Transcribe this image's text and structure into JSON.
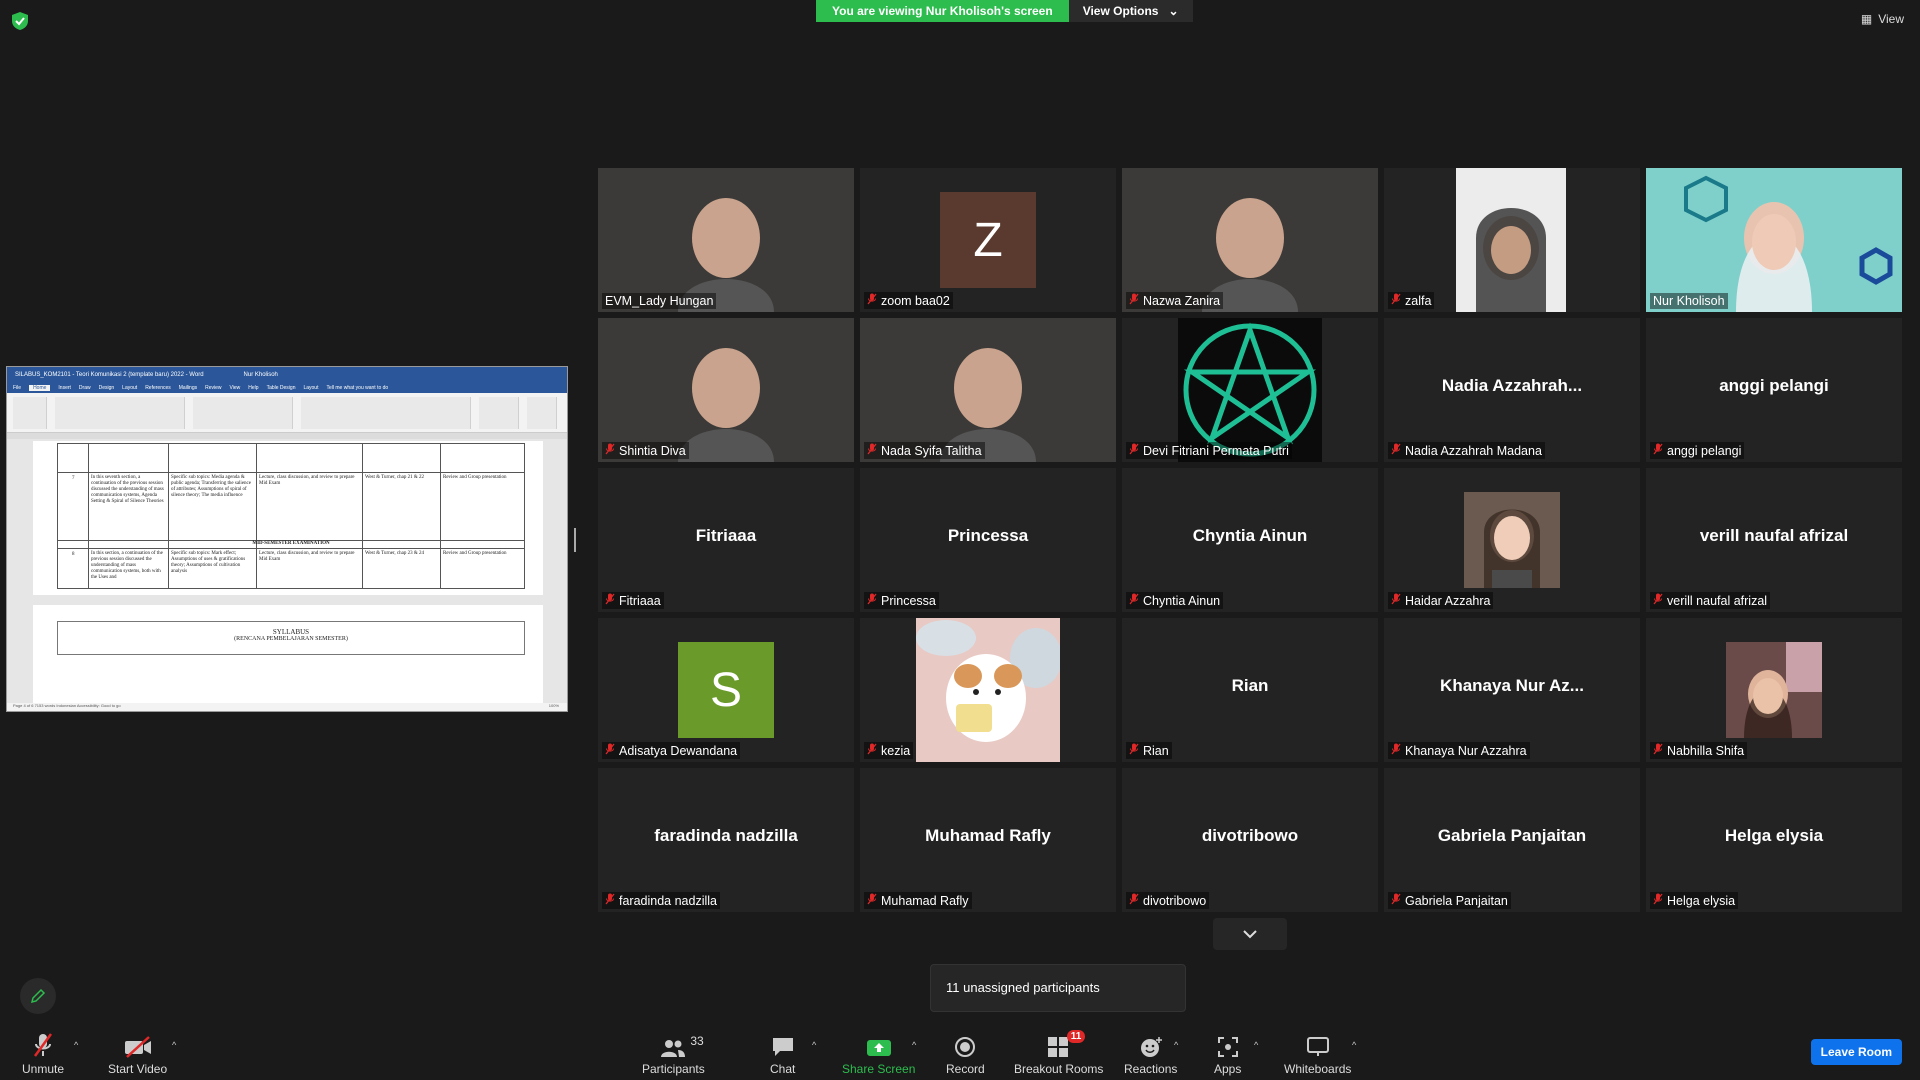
{
  "banner": {
    "viewing_text": "You are viewing Nur Kholisoh's screen",
    "view_options": "View Options"
  },
  "top_right": {
    "view_label": "View"
  },
  "shared_doc": {
    "title": "SILABUS_KOM2101 - Teori Komunikasi 2 (template baru) 2022 - Word",
    "tabs": [
      "File",
      "Home",
      "Insert",
      "Draw",
      "Design",
      "Layout",
      "References",
      "Mailings",
      "Review",
      "View",
      "Help",
      "Table Design",
      "Layout"
    ],
    "tell_me": "Tell me what you want to do",
    "user": "Nur Kholisoh",
    "rows": [
      {
        "no": "7",
        "desc": "In this seventh section, a continuation of the previous session discussed the understanding of mass communication systems, Agenda Setting & Spiral of Silence Theories",
        "topics": "Specific sub topics: Media agenda & public agenda; Transferring the salience of attributes; Assumptions of spiral of silence theory; The media influence",
        "method": "Lecture, class discussion, and review to prepare Mid Exam",
        "ref": "West & Turner, chap 21 & 22",
        "assess": "Review and Group presentation"
      },
      {
        "no": "8",
        "desc": "In this section, a continuation of the previous session discussed the understanding of mass communication systems, both with the Uses and",
        "topics": "Specific sub topics: Mark effect; Assumptions of uses & gratifications theory; Assumptions of cultivation analysis",
        "method": "Lecture, class discussion, and review to prepare Mid Exam",
        "ref": "West & Turner, chap 23 & 24",
        "assess": "Review and Group presentation"
      }
    ],
    "mid_exam": "MID-SEMESTER EXAMINATION",
    "syllabus_title": "SYLLABUS",
    "syllabus_sub": "(RENCANA PEMBELAJARAN SEMESTER)",
    "status": "Page 4 of 6   7153 words   Indonesian   Accessibility: Good to go",
    "zoom": "100%"
  },
  "participants_tiles": [
    {
      "name": "EVM_Lady Hungan",
      "muted": false,
      "kind": "video",
      "active": false
    },
    {
      "name": "zoom baa02",
      "muted": true,
      "kind": "avatar",
      "initial": "Z",
      "color": "#5a3a2e"
    },
    {
      "name": "Nazwa Zanira",
      "muted": true,
      "kind": "video"
    },
    {
      "name": "zalfa",
      "muted": true,
      "kind": "video"
    },
    {
      "name": "Nur Kholisoh",
      "muted": false,
      "kind": "video",
      "active": true
    },
    {
      "name": "Shintia Diva",
      "muted": true,
      "kind": "video"
    },
    {
      "name": "Nada Syifa Talitha",
      "muted": true,
      "kind": "video"
    },
    {
      "name": "Devi Fitriani Permata Putri",
      "muted": true,
      "kind": "pentagram"
    },
    {
      "name": "Nadia Azzahrah Madana",
      "display": "Nadia  Azzahrah...",
      "muted": true,
      "kind": "name"
    },
    {
      "name": "anggi pelangi",
      "display": "anggi pelangi",
      "muted": true,
      "kind": "name"
    },
    {
      "name": "Fitriaaa",
      "display": "Fitriaaa",
      "muted": true,
      "kind": "name"
    },
    {
      "name": "Princessa",
      "display": "Princessa",
      "muted": true,
      "kind": "name"
    },
    {
      "name": "Chyntia Ainun",
      "display": "Chyntia Ainun",
      "muted": true,
      "kind": "name"
    },
    {
      "name": "Haidar Azzahra",
      "muted": true,
      "kind": "photo"
    },
    {
      "name": "verill naufal afrizal",
      "display": "verill naufal afrizal",
      "muted": true,
      "kind": "name"
    },
    {
      "name": "Adisatya Dewandana",
      "muted": true,
      "kind": "avatar",
      "initial": "S",
      "color": "#6a9a2a"
    },
    {
      "name": "kezia",
      "muted": true,
      "kind": "cartoon"
    },
    {
      "name": "Rian",
      "display": "Rian",
      "muted": true,
      "kind": "name"
    },
    {
      "name": "Khanaya Nur Azzahra",
      "display": "Khanaya  Nur  Az...",
      "muted": true,
      "kind": "name"
    },
    {
      "name": "Nabhilla Shifa",
      "muted": true,
      "kind": "photo2"
    },
    {
      "name": "faradinda nadzilla",
      "display": "faradinda nadzilla",
      "muted": true,
      "kind": "name"
    },
    {
      "name": "Muhamad Rafly",
      "display": "Muhamad Rafly",
      "muted": true,
      "kind": "name"
    },
    {
      "name": "divotribowo",
      "display": "divotribowo",
      "muted": true,
      "kind": "name"
    },
    {
      "name": "Gabriela Panjaitan",
      "display": "Gabriela Panjaitan",
      "muted": true,
      "kind": "name"
    },
    {
      "name": "Helga elysia",
      "display": "Helga elysia",
      "muted": true,
      "kind": "name"
    }
  ],
  "unassigned": "11 unassigned participants",
  "toolbar": {
    "unmute": "Unmute",
    "start_video": "Start Video",
    "participants": "Participants",
    "participants_count": "33",
    "chat": "Chat",
    "share_screen": "Share Screen",
    "record": "Record",
    "breakout_rooms": "Breakout Rooms",
    "breakout_badge": "11",
    "reactions": "Reactions",
    "apps": "Apps",
    "whiteboards": "Whiteboards",
    "leave": "Leave Room"
  },
  "colors": {
    "banner_green": "#2dbd4e",
    "active_speaker": "#f5f56a",
    "leave_blue": "#0e72ed",
    "mute_red": "#e02828",
    "word_blue": "#2b579a"
  }
}
